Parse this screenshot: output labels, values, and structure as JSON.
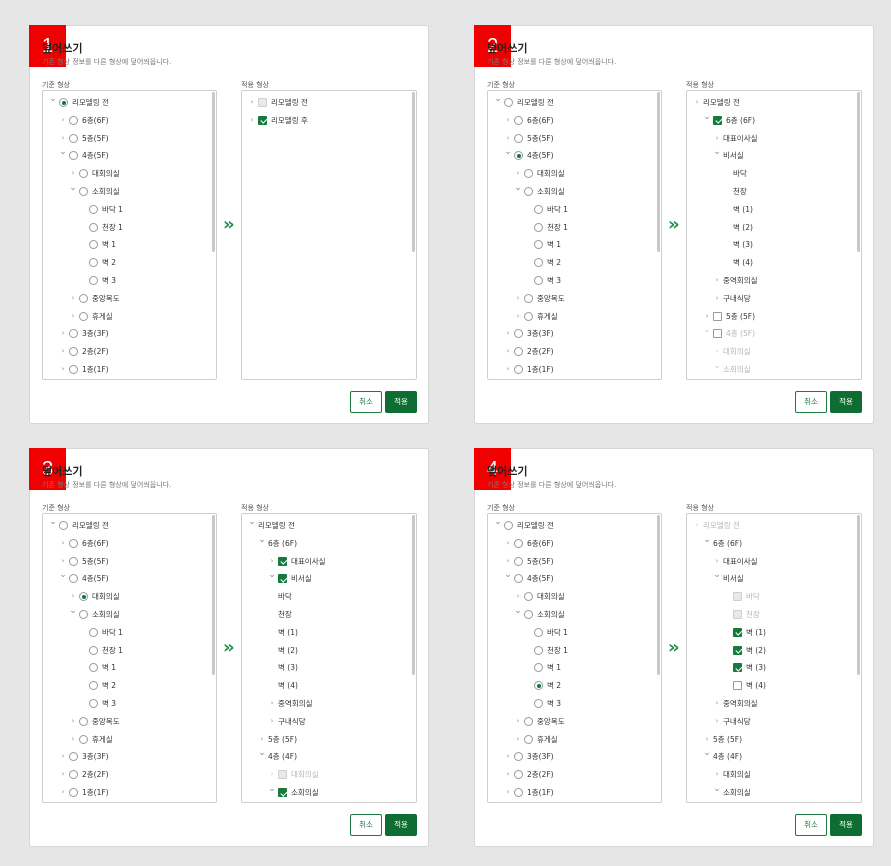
{
  "common": {
    "title": "덮어쓰기",
    "subtitle": "기존 형상 정보를 다른 형상에 덮어씌웁니다.",
    "left_label": "기준 형상",
    "right_label": "적용 형상",
    "cancel": "취소",
    "apply": "적용",
    "arrow": "»",
    "accent_color": "#0e6e31",
    "badge_color": "#f00000"
  },
  "panels": [
    {
      "number": "1",
      "left": [
        {
          "t": "리모델링 전",
          "d": 0,
          "c": "down",
          "m": "radio",
          "s": true
        },
        {
          "t": "6층(6F)",
          "d": 1,
          "c": "right",
          "m": "radio"
        },
        {
          "t": "5층(5F)",
          "d": 1,
          "c": "right",
          "m": "radio"
        },
        {
          "t": "4층(5F)",
          "d": 1,
          "c": "down",
          "m": "radio"
        },
        {
          "t": "대회의실",
          "d": 2,
          "c": "right",
          "m": "radio"
        },
        {
          "t": "소회의실",
          "d": 2,
          "c": "down",
          "m": "radio"
        },
        {
          "t": "바닥 1",
          "d": 3,
          "m": "radio"
        },
        {
          "t": "천장 1",
          "d": 3,
          "m": "radio"
        },
        {
          "t": "벽 1",
          "d": 3,
          "m": "radio"
        },
        {
          "t": "벽 2",
          "d": 3,
          "m": "radio"
        },
        {
          "t": "벽 3",
          "d": 3,
          "m": "radio"
        },
        {
          "t": "중앙복도",
          "d": 2,
          "c": "right",
          "m": "radio"
        },
        {
          "t": "휴게실",
          "d": 2,
          "c": "right",
          "m": "radio"
        },
        {
          "t": "3층(3F)",
          "d": 1,
          "c": "right",
          "m": "radio"
        },
        {
          "t": "2층(2F)",
          "d": 1,
          "c": "right",
          "m": "radio"
        },
        {
          "t": "1층(1F)",
          "d": 1,
          "c": "right",
          "m": "radio"
        }
      ],
      "right": [
        {
          "t": "리모델링 전",
          "d": 0,
          "c": "right",
          "m": "check",
          "dis": true
        },
        {
          "t": "리모델링 후",
          "d": 0,
          "c": "right",
          "m": "check",
          "s": true
        }
      ]
    },
    {
      "number": "2",
      "left": [
        {
          "t": "리모델링 전",
          "d": 0,
          "c": "down",
          "m": "radio"
        },
        {
          "t": "6층(6F)",
          "d": 1,
          "c": "right",
          "m": "radio"
        },
        {
          "t": "5층(5F)",
          "d": 1,
          "c": "right",
          "m": "radio"
        },
        {
          "t": "4층(5F)",
          "d": 1,
          "c": "down",
          "m": "radio",
          "s": true
        },
        {
          "t": "대회의실",
          "d": 2,
          "c": "right",
          "m": "radio"
        },
        {
          "t": "소회의실",
          "d": 2,
          "c": "down",
          "m": "radio"
        },
        {
          "t": "바닥 1",
          "d": 3,
          "m": "radio"
        },
        {
          "t": "천장 1",
          "d": 3,
          "m": "radio"
        },
        {
          "t": "벽 1",
          "d": 3,
          "m": "radio"
        },
        {
          "t": "벽 2",
          "d": 3,
          "m": "radio"
        },
        {
          "t": "벽 3",
          "d": 3,
          "m": "radio"
        },
        {
          "t": "중앙복도",
          "d": 2,
          "c": "right",
          "m": "radio"
        },
        {
          "t": "휴게실",
          "d": 2,
          "c": "right",
          "m": "radio"
        },
        {
          "t": "3층(3F)",
          "d": 1,
          "c": "right",
          "m": "radio"
        },
        {
          "t": "2층(2F)",
          "d": 1,
          "c": "right",
          "m": "radio"
        },
        {
          "t": "1층(1F)",
          "d": 1,
          "c": "right",
          "m": "radio"
        }
      ],
      "right": [
        {
          "t": "리모델링 전",
          "d": 0,
          "c": "right"
        },
        {
          "t": "6층 (6F)",
          "d": 1,
          "c": "down",
          "m": "check",
          "s": true
        },
        {
          "t": "대표이사실",
          "d": 2,
          "c": "right"
        },
        {
          "t": "비서실",
          "d": 2,
          "c": "down"
        },
        {
          "t": "바닥",
          "d": 3
        },
        {
          "t": "천장",
          "d": 3
        },
        {
          "t": "벽 (1)",
          "d": 3
        },
        {
          "t": "벽 (2)",
          "d": 3
        },
        {
          "t": "벽 (3)",
          "d": 3
        },
        {
          "t": "벽 (4)",
          "d": 3
        },
        {
          "t": "중역회의실",
          "d": 2,
          "c": "right"
        },
        {
          "t": "구내식당",
          "d": 2,
          "c": "right"
        },
        {
          "t": "5층 (5F)",
          "d": 1,
          "c": "right",
          "m": "check"
        },
        {
          "t": "4층 (5F)",
          "d": 1,
          "c": "down",
          "m": "check",
          "dim": true
        },
        {
          "t": "대회의실",
          "d": 2,
          "c": "right",
          "dim": true
        },
        {
          "t": "소회의실",
          "d": 2,
          "c": "down",
          "dim": true
        }
      ]
    },
    {
      "number": "3",
      "left": [
        {
          "t": "리모델링 전",
          "d": 0,
          "c": "down",
          "m": "radio"
        },
        {
          "t": "6층(6F)",
          "d": 1,
          "c": "right",
          "m": "radio"
        },
        {
          "t": "5층(5F)",
          "d": 1,
          "c": "right",
          "m": "radio"
        },
        {
          "t": "4층(5F)",
          "d": 1,
          "c": "down",
          "m": "radio"
        },
        {
          "t": "대회의실",
          "d": 2,
          "c": "right",
          "m": "radio",
          "s": true
        },
        {
          "t": "소회의실",
          "d": 2,
          "c": "down",
          "m": "radio"
        },
        {
          "t": "바닥 1",
          "d": 3,
          "m": "radio"
        },
        {
          "t": "천장 1",
          "d": 3,
          "m": "radio"
        },
        {
          "t": "벽 1",
          "d": 3,
          "m": "radio"
        },
        {
          "t": "벽 2",
          "d": 3,
          "m": "radio"
        },
        {
          "t": "벽 3",
          "d": 3,
          "m": "radio"
        },
        {
          "t": "중앙복도",
          "d": 2,
          "c": "right",
          "m": "radio"
        },
        {
          "t": "휴게실",
          "d": 2,
          "c": "right",
          "m": "radio"
        },
        {
          "t": "3층(3F)",
          "d": 1,
          "c": "right",
          "m": "radio"
        },
        {
          "t": "2층(2F)",
          "d": 1,
          "c": "right",
          "m": "radio"
        },
        {
          "t": "1층(1F)",
          "d": 1,
          "c": "right",
          "m": "radio"
        }
      ],
      "right": [
        {
          "t": "리모델링 전",
          "d": 0,
          "c": "down"
        },
        {
          "t": "6층 (6F)",
          "d": 1,
          "c": "down"
        },
        {
          "t": "대표이사실",
          "d": 2,
          "c": "right",
          "m": "check",
          "s": true
        },
        {
          "t": "비서실",
          "d": 2,
          "c": "down",
          "m": "check",
          "s": true
        },
        {
          "t": "바닥",
          "d": 2
        },
        {
          "t": "천장",
          "d": 2
        },
        {
          "t": "벽 (1)",
          "d": 2
        },
        {
          "t": "벽 (2)",
          "d": 2
        },
        {
          "t": "벽 (3)",
          "d": 2
        },
        {
          "t": "벽 (4)",
          "d": 2
        },
        {
          "t": "중역회의실",
          "d": 2,
          "c": "right"
        },
        {
          "t": "구내식당",
          "d": 2,
          "c": "right"
        },
        {
          "t": "5층 (5F)",
          "d": 1,
          "c": "right"
        },
        {
          "t": "4층 (4F)",
          "d": 1,
          "c": "down"
        },
        {
          "t": "대회의실",
          "d": 2,
          "c": "right",
          "m": "check",
          "dis": true,
          "dim": true
        },
        {
          "t": "소회의실",
          "d": 2,
          "c": "down",
          "m": "check",
          "s": true
        }
      ]
    },
    {
      "number": "4",
      "left": [
        {
          "t": "리모델링 전",
          "d": 0,
          "c": "down",
          "m": "radio"
        },
        {
          "t": "6층(6F)",
          "d": 1,
          "c": "right",
          "m": "radio"
        },
        {
          "t": "5층(5F)",
          "d": 1,
          "c": "right",
          "m": "radio"
        },
        {
          "t": "4층(5F)",
          "d": 1,
          "c": "down",
          "m": "radio"
        },
        {
          "t": "대회의실",
          "d": 2,
          "c": "right",
          "m": "radio"
        },
        {
          "t": "소회의실",
          "d": 2,
          "c": "down",
          "m": "radio"
        },
        {
          "t": "바닥 1",
          "d": 3,
          "m": "radio"
        },
        {
          "t": "천장 1",
          "d": 3,
          "m": "radio"
        },
        {
          "t": "벽 1",
          "d": 3,
          "m": "radio"
        },
        {
          "t": "벽 2",
          "d": 3,
          "m": "radio",
          "s": true
        },
        {
          "t": "벽 3",
          "d": 3,
          "m": "radio"
        },
        {
          "t": "중앙복도",
          "d": 2,
          "c": "right",
          "m": "radio"
        },
        {
          "t": "휴게실",
          "d": 2,
          "c": "right",
          "m": "radio"
        },
        {
          "t": "3층(3F)",
          "d": 1,
          "c": "right",
          "m": "radio"
        },
        {
          "t": "2층(2F)",
          "d": 1,
          "c": "right",
          "m": "radio"
        },
        {
          "t": "1층(1F)",
          "d": 1,
          "c": "right",
          "m": "radio"
        }
      ],
      "right": [
        {
          "t": "리모델링 전",
          "d": 0,
          "c": "right",
          "dim": true
        },
        {
          "t": "6층 (6F)",
          "d": 1,
          "c": "down"
        },
        {
          "t": "대표이사실",
          "d": 2,
          "c": "right"
        },
        {
          "t": "비서실",
          "d": 2,
          "c": "down"
        },
        {
          "t": "바닥",
          "d": 3,
          "m": "check",
          "dis": true,
          "dim": true
        },
        {
          "t": "천장",
          "d": 3,
          "m": "check",
          "dis": true,
          "dim": true
        },
        {
          "t": "벽 (1)",
          "d": 3,
          "m": "check",
          "s": true
        },
        {
          "t": "벽 (2)",
          "d": 3,
          "m": "check",
          "s": true
        },
        {
          "t": "벽 (3)",
          "d": 3,
          "m": "check",
          "s": true
        },
        {
          "t": "벽 (4)",
          "d": 3,
          "m": "check"
        },
        {
          "t": "중역회의실",
          "d": 2,
          "c": "right"
        },
        {
          "t": "구내식당",
          "d": 2,
          "c": "right"
        },
        {
          "t": "5층 (5F)",
          "d": 1,
          "c": "right"
        },
        {
          "t": "4층 (4F)",
          "d": 1,
          "c": "down"
        },
        {
          "t": "대회의실",
          "d": 2,
          "c": "right"
        },
        {
          "t": "소회의실",
          "d": 2,
          "c": "down"
        }
      ]
    }
  ]
}
